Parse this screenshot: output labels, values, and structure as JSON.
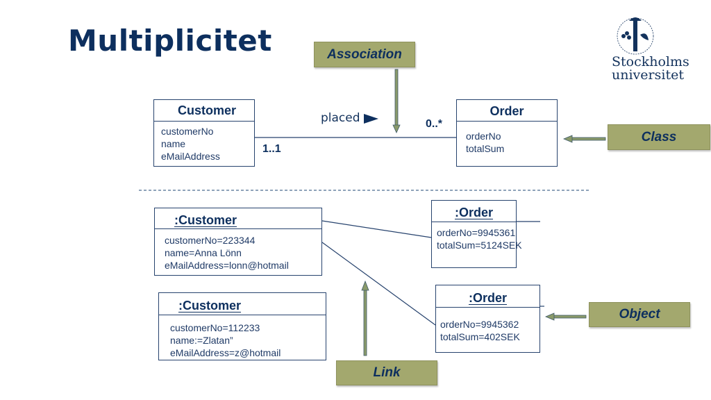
{
  "slide": {
    "title": "Multiplicitet",
    "logo": {
      "icon": "stockholm-university-seal-icon",
      "line1": "Stockholms",
      "line2": "universitet"
    }
  },
  "class_diagram": {
    "customer": {
      "name": "Customer",
      "attributes": [
        "customerNo",
        "name",
        "eMailAddress"
      ]
    },
    "order": {
      "name": "Order",
      "attributes": [
        "orderNo",
        "totalSum"
      ]
    },
    "association": {
      "label": "placed",
      "direction_icon": "triangle-right-icon",
      "multiplicity_customer": "1..1",
      "multiplicity_order": "0..*"
    }
  },
  "object_diagram": {
    "customers": [
      {
        "name": ":Customer",
        "attributes": [
          "customerNo=223344",
          "name=Anna Lönn",
          "eMailAddress=lonn@hotmail"
        ]
      },
      {
        "name": ":Customer",
        "attributes": [
          "customerNo=112233",
          "name:=Zlatan”",
          "eMailAddress=z@hotmail"
        ]
      }
    ],
    "orders": [
      {
        "name": ":Order",
        "attributes": [
          "orderNo=9945361",
          "totalSum=5124SEK"
        ]
      },
      {
        "name": ":Order",
        "attributes": [
          "orderNo=9945362",
          "totalSum=402SEK"
        ]
      }
    ]
  },
  "callouts": {
    "association": "Association",
    "class": "Class",
    "object": "Object",
    "link": "Link"
  },
  "colors": {
    "navy": "#0d2f5e",
    "callout_fill": "#a3a86e",
    "arrow_fill": "#8a9a6a"
  }
}
